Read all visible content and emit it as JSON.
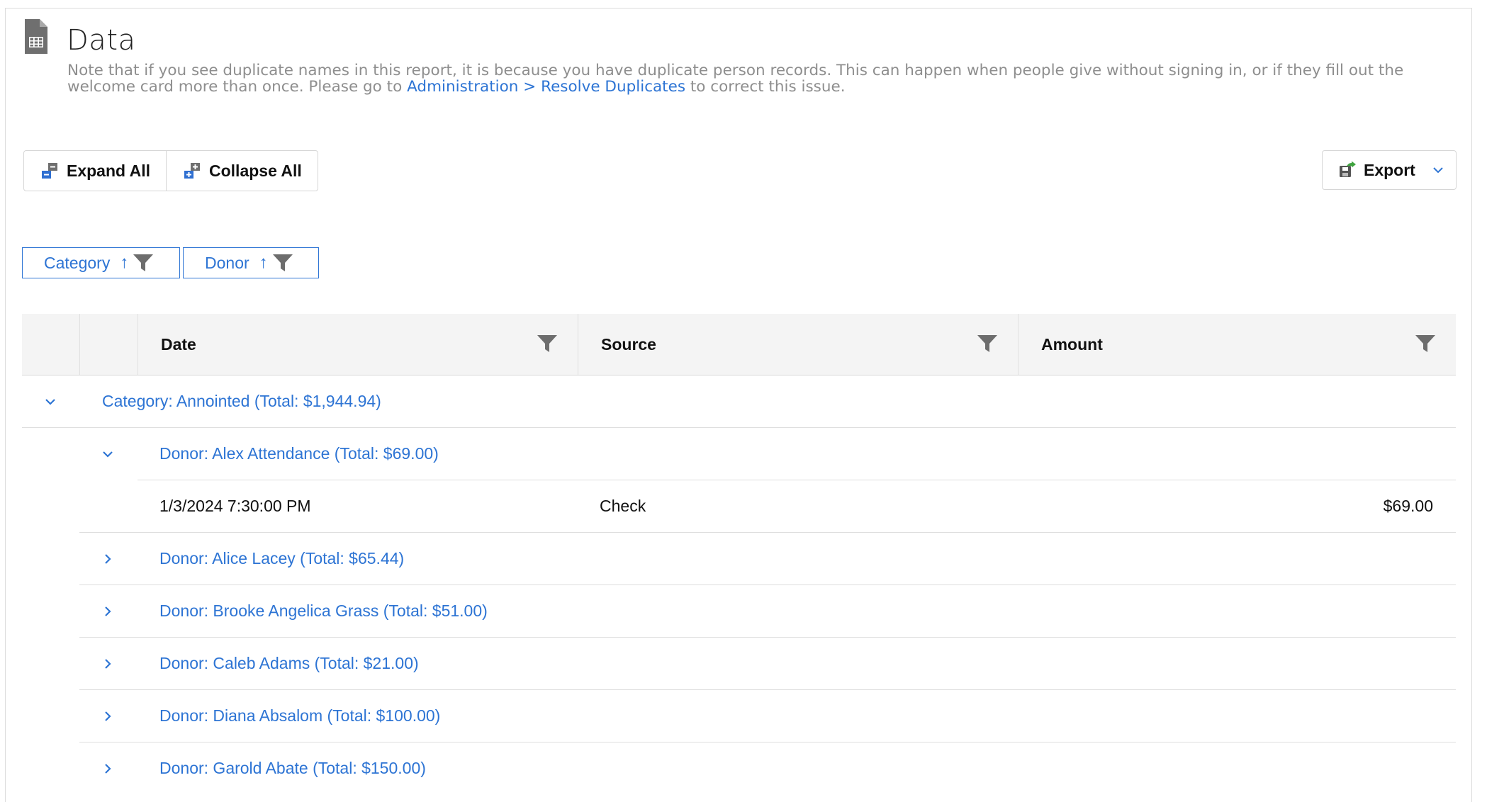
{
  "header": {
    "title": "Data",
    "note_main": "Note that if you see duplicate names in this report, it is because you have duplicate person records. This can happen when people give without signing in, or if they fill out the welcome card more than once. Please go to ",
    "note_link": "Administration > Resolve Duplicates",
    "note_end": " to correct this issue."
  },
  "toolbar": {
    "expand_all": "Expand All",
    "collapse_all": "Collapse All",
    "export": "Export"
  },
  "group_chips": [
    {
      "label": "Category",
      "sort": "↑"
    },
    {
      "label": "Donor",
      "sort": "↑"
    }
  ],
  "columns": {
    "date": "Date",
    "source": "Source",
    "amount": "Amount"
  },
  "rows": {
    "category": "Category: Annointed (Total: $1,944.94)",
    "donor_alex": "Donor: Alex Attendance (Total: $69.00)",
    "detail": {
      "date": "1/3/2024 7:30:00 PM",
      "source": "Check",
      "amount": "$69.00"
    },
    "donor_alice": "Donor: Alice Lacey (Total: $65.44)",
    "donor_brooke": "Donor: Brooke Angelica Grass (Total: $51.00)",
    "donor_caleb": "Donor: Caleb Adams (Total: $21.00)",
    "donor_diana": "Donor: Diana Absalom (Total: $100.00)",
    "donor_garold": "Donor: Garold Abate (Total: $150.00)"
  },
  "colors": {
    "link": "#2d74d4",
    "note": "#8e8e8e",
    "header_bg": "#f4f4f4"
  }
}
